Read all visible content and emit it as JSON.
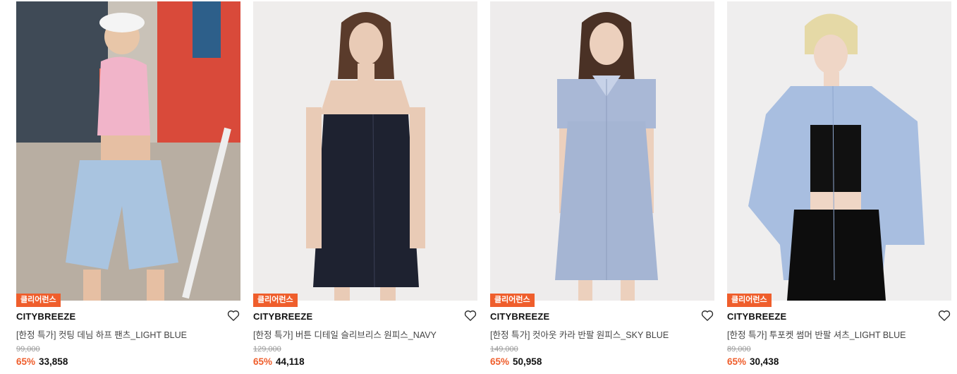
{
  "products": [
    {
      "badge": "클리어런스",
      "brand": "CITYBREEZE",
      "name": "[한정 특가] 컷팅 데님 하프 팬츠_LIGHT BLUE",
      "original_price": "99,000",
      "discount": "65%",
      "price": "33,858",
      "wishlist_icon": "heart-outline-icon"
    },
    {
      "badge": "클리어런스",
      "brand": "CITYBREEZE",
      "name": "[한정 특가] 버튼 디테일 슬리브리스 원피스_NAVY",
      "original_price": "129,000",
      "discount": "65%",
      "price": "44,118",
      "wishlist_icon": "heart-outline-icon"
    },
    {
      "badge": "클리어런스",
      "brand": "CITYBREEZE",
      "name": "[한정 특가] 컷아웃 카라 반팔 원피스_SKY BLUE",
      "original_price": "149,000",
      "discount": "65%",
      "price": "50,958",
      "wishlist_icon": "heart-outline-icon"
    },
    {
      "badge": "클리어런스",
      "brand": "CITYBREEZE",
      "name": "[한정 특가] 투포켓 썸머 반팔 셔츠_LIGHT BLUE",
      "original_price": "89,000",
      "discount": "65%",
      "price": "30,438",
      "wishlist_icon": "heart-outline-icon"
    }
  ],
  "colors": {
    "accent": "#ef5e2c",
    "text": "#111111",
    "muted": "#9a9a9a"
  }
}
